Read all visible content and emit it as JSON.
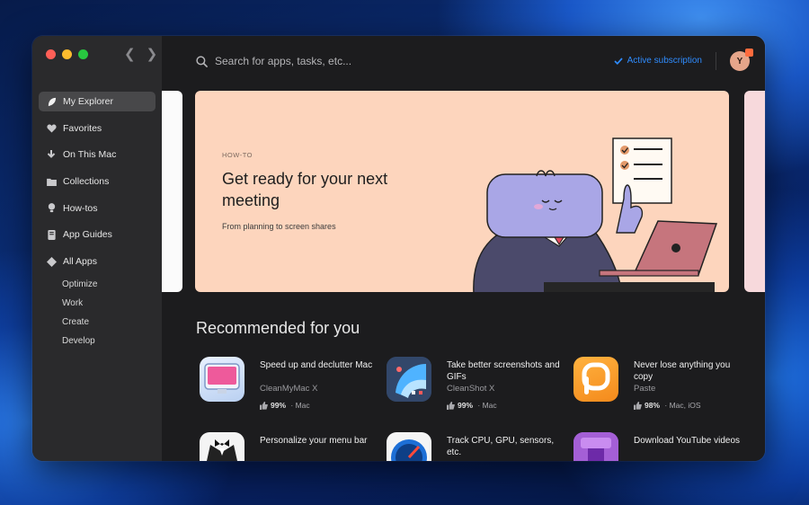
{
  "sidebar": {
    "items": [
      {
        "label": "My Explorer",
        "icon": "leaf-icon",
        "active": true
      },
      {
        "label": "Favorites",
        "icon": "heart-icon"
      },
      {
        "label": "On This Mac",
        "icon": "download-arrow-icon"
      },
      {
        "label": "Collections",
        "icon": "folder-icon"
      },
      {
        "label": "How-tos",
        "icon": "lightbulb-icon"
      },
      {
        "label": "App Guides",
        "icon": "book-icon"
      },
      {
        "label": "All Apps",
        "icon": "diamond-icon"
      }
    ],
    "subitems": [
      "Optimize",
      "Work",
      "Create",
      "Develop"
    ]
  },
  "header": {
    "search_placeholder": "Search for apps, tasks, etc...",
    "subscription_label": "Active subscription",
    "avatar_initial": "Y",
    "accent_color": "#2f8cff"
  },
  "banner": {
    "kicker": "HOW-TO",
    "title": "Get ready for your next meeting",
    "subtitle": "From planning to screen shares",
    "background": "#fdd5bd"
  },
  "recommended": {
    "title": "Recommended for you",
    "apps": [
      {
        "title": "Speed up and declutter Mac",
        "name": "CleanMyMac X",
        "rating": "99%",
        "platforms": "Mac"
      },
      {
        "title": "Take better screenshots and GIFs",
        "name": "CleanShot X",
        "rating": "99%",
        "platforms": "Mac"
      },
      {
        "title": "Never lose anything you copy",
        "name": "Paste",
        "rating": "98%",
        "platforms": "Mac, iOS"
      },
      {
        "title": "Personalize your menu bar",
        "name": "",
        "rating": "",
        "platforms": ""
      },
      {
        "title": "Track CPU, GPU, sensors, etc.",
        "name": "",
        "rating": "",
        "platforms": ""
      },
      {
        "title": "Download YouTube videos",
        "name": "",
        "rating": "",
        "platforms": ""
      }
    ]
  }
}
